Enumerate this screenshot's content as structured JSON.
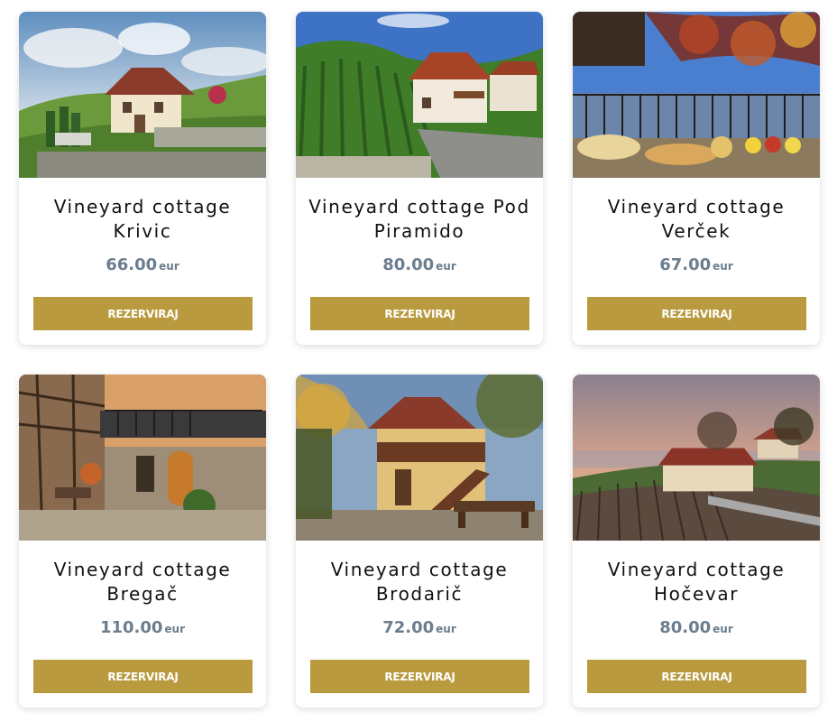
{
  "currency": "eur",
  "button_label": "REZERVIRAJ",
  "colors": {
    "button": "#b99a3e",
    "price": "#6b7d8e",
    "title": "#111111"
  },
  "cottages": [
    {
      "name": "Vineyard cottage Krivic",
      "price": "66.00",
      "currency": "eur",
      "button": "REZERVIRAJ"
    },
    {
      "name": "Vineyard cottage Pod Piramido",
      "price": "80.00",
      "currency": "eur",
      "button": "REZERVIRAJ"
    },
    {
      "name": "Vineyard cottage Verček",
      "price": "67.00",
      "currency": "eur",
      "button": "REZERVIRAJ"
    },
    {
      "name": "Vineyard cottage Bregač",
      "price": "110.00",
      "currency": "eur",
      "button": "REZERVIRAJ"
    },
    {
      "name": "Vineyard cottage Brodarič",
      "price": "72.00",
      "currency": "eur",
      "button": "REZERVIRAJ"
    },
    {
      "name": "Vineyard cottage Hočevar",
      "price": "80.00",
      "currency": "eur",
      "button": "REZERVIRAJ"
    }
  ]
}
